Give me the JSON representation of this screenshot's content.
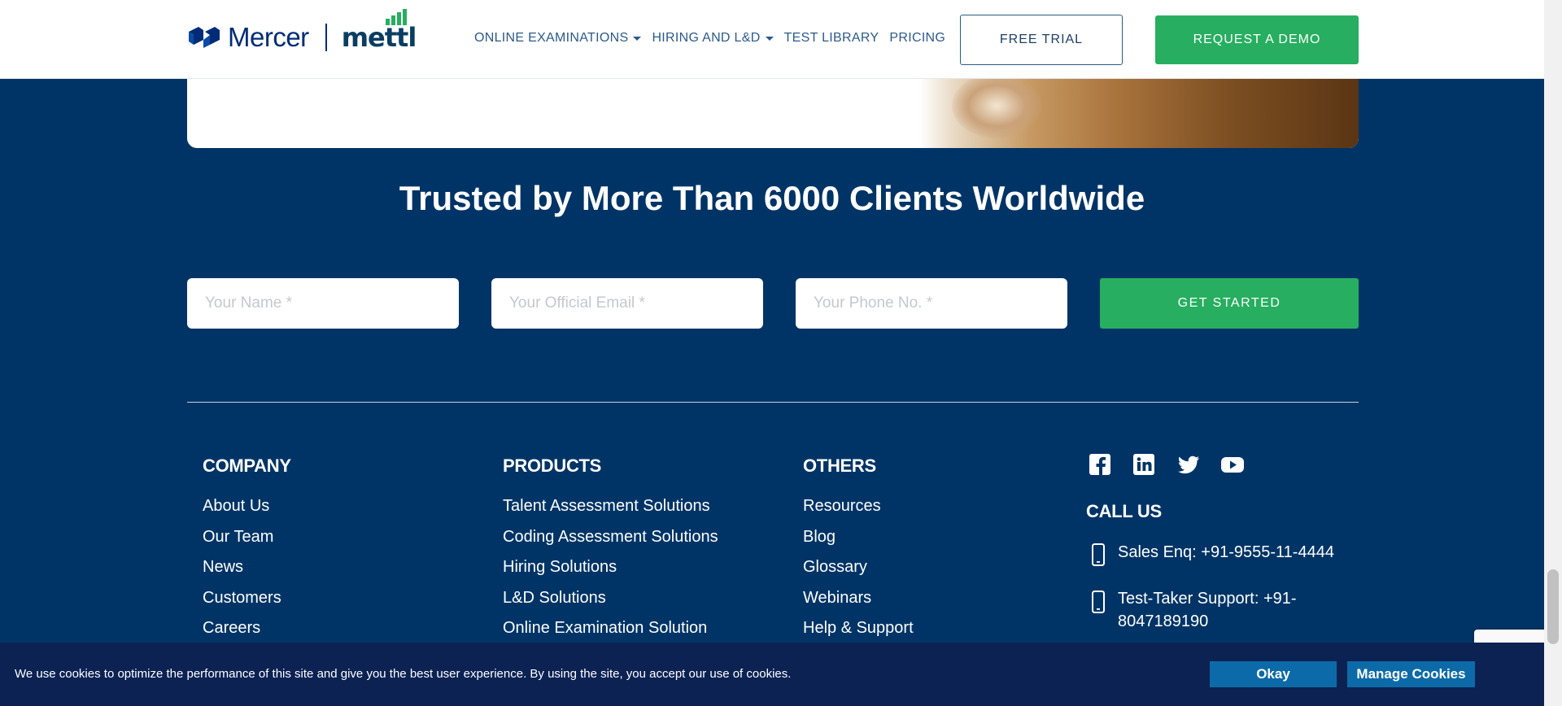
{
  "header": {
    "logo_mercer": "Mercer",
    "logo_mettl": "mettl",
    "nav": [
      {
        "label": "ONLINE EXAMINATIONS",
        "dropdown": true
      },
      {
        "label": "HIRING AND L&D",
        "dropdown": true
      },
      {
        "label": "TEST LIBRARY",
        "dropdown": false
      },
      {
        "label": "PRICING",
        "dropdown": false
      }
    ],
    "free_trial_label": "FREE TRIAL",
    "request_demo_label": "REQUEST A DEMO"
  },
  "trusted": {
    "headline": "Trusted by More Than 6000 Clients Worldwide"
  },
  "form": {
    "name_placeholder": "Your Name *",
    "email_placeholder": "Your Official Email *",
    "phone_placeholder": "Your Phone No. *",
    "submit_label": "GET STARTED"
  },
  "footer": {
    "company": {
      "title": "COMPANY",
      "links": [
        "About Us",
        "Our Team",
        "News",
        "Customers",
        "Careers"
      ]
    },
    "products": {
      "title": "PRODUCTS",
      "links": [
        "Talent Assessment Solutions",
        "Coding Assessment Solutions",
        "Hiring Solutions",
        "L&D Solutions",
        "Online Examination Solution"
      ]
    },
    "others": {
      "title": "OTHERS",
      "links": [
        "Resources",
        "Blog",
        "Glossary",
        "Webinars",
        "Help & Support"
      ]
    },
    "social_icons": [
      "facebook-icon",
      "linkedin-icon",
      "twitter-icon",
      "youtube-icon"
    ],
    "call_us": {
      "title": "CALL US",
      "sales": "Sales Enq: +91-9555-11-4444",
      "support_line1": "Test-Taker Support: +91-",
      "support_line2": "8047189190"
    }
  },
  "cookie": {
    "text": "We use cookies to optimize the performance of this site and give you the best user experience. By using the site, you accept our use of cookies.",
    "okay_label": "Okay",
    "manage_label": "Manage Cookies"
  },
  "colors": {
    "page_bg": "#003466",
    "accent_green": "#27ae60",
    "brand_navy": "#002c77",
    "cookie_bg": "#0b2253",
    "cookie_button": "#0d6aa8"
  }
}
